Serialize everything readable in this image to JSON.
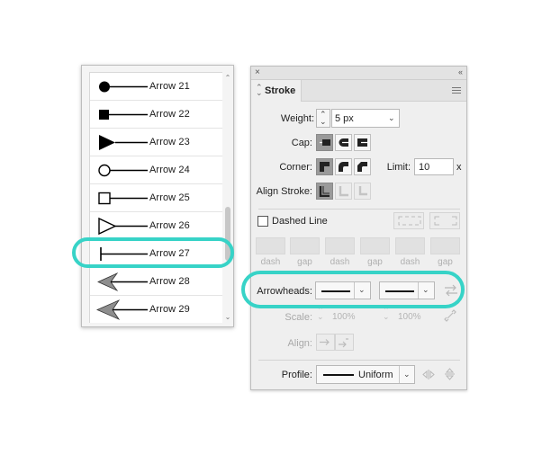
{
  "arrow_list": {
    "items": [
      {
        "label": "Arrow 21",
        "icon": "circle-filled-arrowhead-icon"
      },
      {
        "label": "Arrow 22",
        "icon": "square-filled-arrowhead-icon"
      },
      {
        "label": "Arrow 23",
        "icon": "triangle-filled-arrowhead-icon"
      },
      {
        "label": "Arrow 24",
        "icon": "circle-open-arrowhead-icon"
      },
      {
        "label": "Arrow 25",
        "icon": "square-open-arrowhead-icon"
      },
      {
        "label": "Arrow 26",
        "icon": "triangle-open-arrowhead-icon"
      },
      {
        "label": "Arrow 27",
        "icon": "bar-arrowhead-icon"
      },
      {
        "label": "Arrow 28",
        "icon": "barbed-arrowhead-icon"
      },
      {
        "label": "Arrow 29",
        "icon": "barbed-large-arrowhead-icon"
      }
    ],
    "highlighted": "Arrow 27"
  },
  "panel": {
    "close_glyph": "×",
    "collapse_glyph": "‹‹",
    "tab_title": "Stroke",
    "weight_label": "Weight:",
    "weight_value": "5 px",
    "cap_label": "Cap:",
    "corner_label": "Corner:",
    "limit_label": "Limit:",
    "limit_value": "10",
    "limit_suffix": "x",
    "align_label": "Align Stroke:",
    "dashed_label": "Dashed Line",
    "dash_labels": [
      "dash",
      "gap",
      "dash",
      "gap",
      "dash",
      "gap"
    ],
    "arrowheads_label": "Arrowheads:",
    "scale_label": "Scale:",
    "scale_start": "100%",
    "scale_end": "100%",
    "align_arrow_label": "Align:",
    "profile_label": "Profile:",
    "profile_value": "Uniform"
  },
  "colors": {
    "highlight": "#37d3c7",
    "selected_button": "#9a9a9a"
  }
}
